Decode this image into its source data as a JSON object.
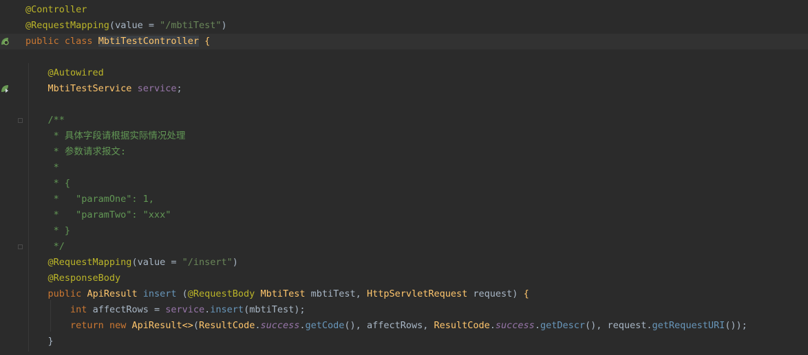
{
  "editor": {
    "background": "#2b2b2b",
    "current_line_background": "#323232",
    "lines": [
      "@Controller",
      "@RequestMapping(value = \"/mbtiTest\")",
      "public class MbtiTestController {",
      "",
      "    @Autowired",
      "    MbtiTestService service;",
      "",
      "    /**",
      "     * 具体字段请根据实际情况处理",
      "     * 参数请求报文:",
      "     *",
      "     * {",
      "     *   \"paramOne\": 1,",
      "     *   \"paramTwo\": \"xxx\"",
      "     * }",
      "     */",
      "    @RequestMapping(value = \"/insert\")",
      "    @ResponseBody",
      "    public ApiResult insert (@RequestBody MbtiTest mbtiTest, HttpServletRequest request) {",
      "        int affectRows = service.insert(mbtiTest);",
      "        return new ApiResult<>(ResultCode.success.getCode(), affectRows, ResultCode.success.getDescr(), request.getRequestURI());",
      "    }"
    ],
    "gutter_icons": [
      "spring-bean-class-icon",
      "spring-autowired-icon"
    ],
    "colors": {
      "annotation": "#bbb529",
      "keyword": "#cc7832",
      "string": "#6a8759",
      "class_name": "#ffc66d",
      "field": "#9876aa",
      "number": "#6897bb",
      "doc_comment": "#629755",
      "default_text": "#a9b7c6"
    }
  }
}
